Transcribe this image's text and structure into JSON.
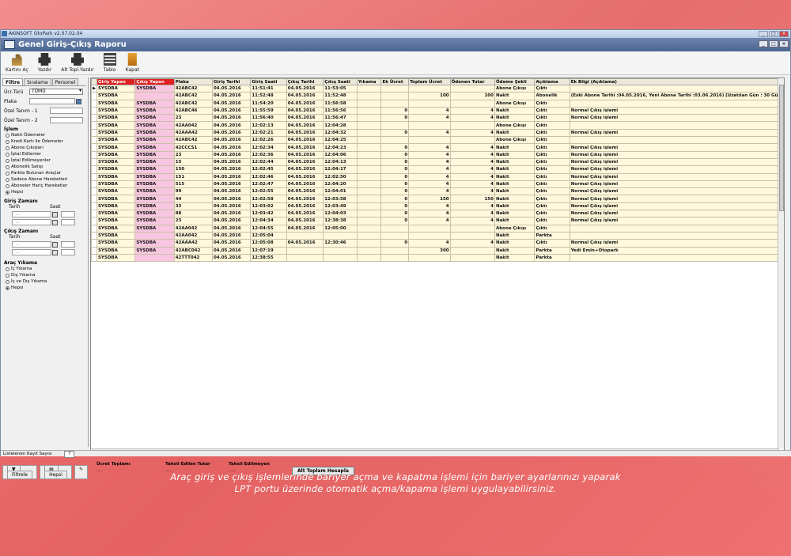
{
  "window": {
    "title": "AKINSOFT OtoPark v2.07.02.04"
  },
  "header": {
    "title": "Genel Giriş-Çıkış Raporu"
  },
  "toolbar": {
    "items": [
      {
        "label": "Kartını Aç",
        "icon": "barrier-icon"
      },
      {
        "label": "Yazdır",
        "icon": "printer-icon"
      },
      {
        "label": "Alt Topl.Yazdır",
        "icon": "printer-icon"
      },
      {
        "label": "Tablo",
        "icon": "table-icon"
      },
      {
        "label": "Kapat",
        "icon": "exit-icon"
      }
    ]
  },
  "left": {
    "tabs": [
      "Filtre",
      "Sıralama",
      "Personel"
    ],
    "ucr_turu_label": "Ücr.Türü",
    "ucr_turu_value": "TÜMÜ",
    "plaka_label": "Plaka",
    "ozel1_label": "Özel Tanım - 1",
    "ozel2_label": "Özel Tanım - 2",
    "islem_label": "İşlem",
    "islem_options": [
      "Nakit Ödemeler",
      "Kredi Kartı ile Ödemeler",
      "Abone Çıkışları",
      "İptal Edilenler",
      "İptal Edilmeyenler",
      "Abonelik Satışı",
      "Parkta Bulunan Araçlar",
      "Sadece Abone Hareketleri",
      "Aboneler Hariç Hareketler",
      "Hepsi"
    ],
    "islem_selected": 9,
    "giris_zamani_label": "Giriş Zamanı",
    "cikis_zamani_label": "Çıkış Zamanı",
    "tarih_label": "Tarih",
    "saat_label": "Saat",
    "date_placeholder": ". .",
    "arac_yikama_label": "Araç Yıkama",
    "yikama_options": [
      "İç Yıkama",
      "Dış Yıkama",
      "İç ve Dış Yıkama",
      "Hepsi"
    ],
    "yikama_selected": 3,
    "filter_button": "Filtrele",
    "all_button": "Hepsi"
  },
  "grid": {
    "columns": [
      "Giriş Yapan",
      "Çıkış Yapan",
      "Plaka",
      "Giriş Tarihi",
      "Giriş Saati",
      "Çıkış Tarihi",
      "Çıkış Saati",
      "Yıkama",
      "Ek Ücret",
      "Toplam Ücret",
      "Ödenen Tutar",
      "Ödeme Şekli",
      "Açıklama",
      "Ek Bilgi (Açıklama)"
    ],
    "rows": [
      [
        "SYSDBA",
        "SYSDBA",
        "42ABC42",
        "04.05.2016",
        "11:51:41",
        "04.05.2016",
        "11:53:05",
        "",
        "",
        "",
        "",
        "Abone Çıkışı",
        "Çıktı",
        ""
      ],
      [
        "SYSDBA",
        "",
        "42ABC42",
        "04.05.2016",
        "11:52:48",
        "04.05.2016",
        "11:52:48",
        "",
        "",
        "100",
        "100",
        "Nakit",
        "Abonelik",
        "(Eski Abone Tarihi :04.05.2016, Yeni Abone Tarihi :03.06.2016) [Uzatılan Gün : 30 Gün]"
      ],
      [
        "SYSDBA",
        "SYSDBA",
        "42ABC42",
        "04.05.2016",
        "11:54:20",
        "04.05.2016",
        "11:56:58",
        "",
        "",
        "",
        "",
        "Abone Çıkışı",
        "Çıktı",
        ""
      ],
      [
        "SYSDBA",
        "SYSDBA",
        "42ABC46",
        "04.05.2016",
        "11:55:59",
        "04.05.2016",
        "11:56:56",
        "",
        "0",
        "4",
        "4",
        "Nakit",
        "Çıktı",
        "Normal Çıkış işlemi"
      ],
      [
        "SYSDBA",
        "SYSDBA",
        "23",
        "04.05.2016",
        "11:56:40",
        "04.05.2016",
        "11:56:47",
        "",
        "0",
        "4",
        "4",
        "Nakit",
        "Çıktı",
        "Normal Çıkış işlemi"
      ],
      [
        "SYSDBA",
        "SYSDBA",
        "42AA042",
        "04.05.2016",
        "12:02:13",
        "04.05.2016",
        "12:04:28",
        "",
        "",
        "",
        "",
        "Abone Çıkışı",
        "Çıktı",
        ""
      ],
      [
        "SYSDBA",
        "SYSDBA",
        "42AAA42",
        "04.05.2016",
        "12:02:21",
        "04.05.2016",
        "12:04:32",
        "",
        "0",
        "4",
        "4",
        "Nakit",
        "Çıktı",
        "Normal Çıkış işlemi"
      ],
      [
        "SYSDBA",
        "SYSDBA",
        "42ABC42",
        "04.05.2016",
        "12:02:26",
        "04.05.2016",
        "12:04:25",
        "",
        "",
        "",
        "",
        "Abone Çıkışı",
        "Çıktı",
        ""
      ],
      [
        "SYSDBA",
        "SYSDBA",
        "42CCCS1",
        "04.05.2016",
        "12:02:34",
        "04.05.2016",
        "12:04:23",
        "",
        "0",
        "4",
        "4",
        "Nakit",
        "Çıktı",
        "Normal Çıkış işlemi"
      ],
      [
        "SYSDBA",
        "SYSDBA",
        "23",
        "04.05.2016",
        "12:02:36",
        "04.05.2016",
        "12:04:06",
        "",
        "0",
        "4",
        "4",
        "Nakit",
        "Çıktı",
        "Normal Çıkış işlemi"
      ],
      [
        "SYSDBA",
        "SYSDBA",
        "15",
        "04.05.2016",
        "12:02:44",
        "04.05.2016",
        "12:04:13",
        "",
        "0",
        "4",
        "4",
        "Nakit",
        "Çıktı",
        "Normal Çıkış işlemi"
      ],
      [
        "SYSDBA",
        "SYSDBA",
        "150",
        "04.05.2016",
        "12:02:45",
        "04.05.2016",
        "12:04:17",
        "",
        "0",
        "4",
        "4",
        "Nakit",
        "Çıktı",
        "Normal Çıkış işlemi"
      ],
      [
        "SYSDBA",
        "SYSDBA",
        "151",
        "04.05.2016",
        "12:02:46",
        "04.05.2016",
        "12:02:50",
        "",
        "0",
        "4",
        "4",
        "Nakit",
        "Çıktı",
        "Normal Çıkış işlemi"
      ],
      [
        "SYSDBA",
        "SYSDBA",
        "515",
        "04.05.2016",
        "12:02:47",
        "04.05.2016",
        "12:04:20",
        "",
        "0",
        "4",
        "4",
        "Nakit",
        "Çıktı",
        "Normal Çıkış işlemi"
      ],
      [
        "SYSDBA",
        "SYSDBA",
        "99",
        "04.05.2016",
        "12:02:55",
        "04.05.2016",
        "12:04:01",
        "",
        "0",
        "4",
        "4",
        "Nakit",
        "Çıktı",
        "Normal Çıkış işlemi"
      ],
      [
        "SYSDBA",
        "SYSDBA",
        "44",
        "04.05.2016",
        "12:02:58",
        "04.05.2016",
        "12:03:58",
        "",
        "0",
        "150",
        "150",
        "Nakit",
        "Çıktı",
        "Normal Çıkış işlemi"
      ],
      [
        "SYSDBA",
        "SYSDBA",
        "33",
        "04.05.2016",
        "12:03:02",
        "04.05.2016",
        "12:03:49",
        "",
        "0",
        "4",
        "4",
        "Nakit",
        "Çıktı",
        "Normal Çıkış işlemi"
      ],
      [
        "SYSDBA",
        "SYSDBA",
        "88",
        "04.05.2016",
        "12:03:42",
        "04.05.2016",
        "12:04:03",
        "",
        "0",
        "4",
        "4",
        "Nakit",
        "Çıktı",
        "Normal Çıkış işlemi"
      ],
      [
        "SYSDBA",
        "SYSDBA",
        "23",
        "04.05.2016",
        "12:04:34",
        "04.05.2016",
        "12:38:38",
        "",
        "0",
        "4",
        "4",
        "Nakit",
        "Çıktı",
        "Normal Çıkış işlemi"
      ],
      [
        "SYSDBA",
        "SYSDBA",
        "42AA042",
        "04.05.2016",
        "12:04:55",
        "04.05.2016",
        "12:05:00",
        "",
        "",
        "",
        "",
        "Abone Çıkışı",
        "Çıktı",
        ""
      ],
      [
        "SYSDBA",
        "",
        "42AA042",
        "04.05.2016",
        "12:05:04",
        "",
        "",
        "",
        "",
        "",
        "",
        "Nakit",
        "Parkta",
        ""
      ],
      [
        "SYSDBA",
        "SYSDBA",
        "42AAA42",
        "04.05.2016",
        "12:05:08",
        "04.05.2016",
        "12:30:46",
        "",
        "0",
        "4",
        "4",
        "Nakit",
        "Çıktı",
        "Normal Çıkış işlemi"
      ],
      [
        "SYSDBA",
        "SYSDBA",
        "42ABC042",
        "04.05.2016",
        "12:07:19",
        "",
        "",
        "",
        "",
        "300",
        "",
        "Nakit",
        "Parkta",
        "Yedi Emin+Otopark"
      ],
      [
        "SYSDBA",
        "",
        "42TTT042",
        "04.05.2016",
        "12:38:55",
        "",
        "",
        "",
        "",
        "",
        "",
        "Nakit",
        "Parkta",
        ""
      ]
    ]
  },
  "footer": {
    "ucret_toplami_label": "Ücret Toplamı",
    "ucret_toplami_value": ".....",
    "tahsil_edilen_label": "Tahsil Edilen Tutar",
    "tahsil_edilen_value": ".....",
    "tahsil_edilmeyen_label": "Tahsil Edilmeyen",
    "tahsil_edilmeyen_value": ".....",
    "hesapla_button": "Alt Toplam Hesapla"
  },
  "statusbar": {
    "label": "Listelenen Kayıt Sayısı",
    "count": "?"
  },
  "caption": {
    "line1": "Araç giriş ve çıkış işlemlerinde bariyer açma ve kapatma işlemi için bariyer ayarlarınızı yaparak",
    "line2": "LPT portu üzerinde otomatik açma/kapama işlemi uygulayabilirsiniz."
  },
  "colors": {
    "header_red": "#e02020",
    "pink_cell": "#f8c6e0",
    "row_bg": "#fff8dc",
    "title_blue": "#4a6592",
    "background": "#e86b6b"
  }
}
